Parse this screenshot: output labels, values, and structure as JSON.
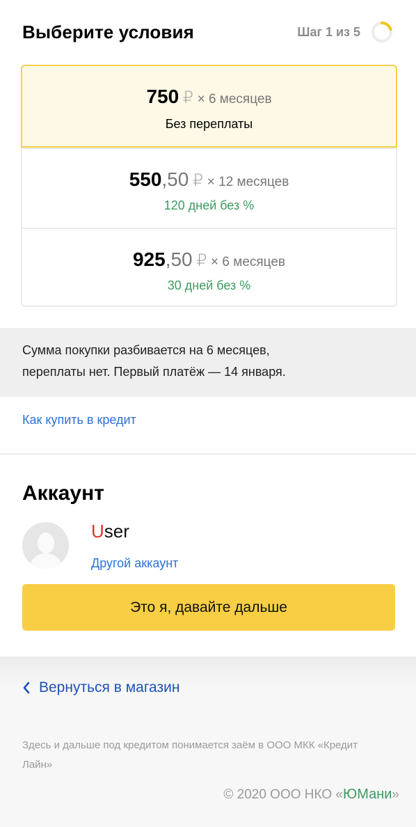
{
  "header": {
    "title": "Выберите условия",
    "step": "Шаг 1 из 5",
    "step_progress": 0.2,
    "ring_color": "#f5c518"
  },
  "options": [
    {
      "amount_main": "750",
      "amount_fraction": "",
      "currency": "₽",
      "multiplier": "× 6 месяцев",
      "subtitle": "Без переплаты",
      "selected": true
    },
    {
      "amount_main": "550",
      "amount_fraction": ",50",
      "currency": "₽",
      "multiplier": "× 12 месяцев",
      "subtitle": "120 дней без %",
      "selected": false
    },
    {
      "amount_main": "925",
      "amount_fraction": ",50",
      "currency": "₽",
      "multiplier": "× 6 месяцев",
      "subtitle": "30 дней без %",
      "selected": false
    }
  ],
  "info": {
    "line1": "Сумма покупки разбивается на 6 месяцев,",
    "line2": "переплаты нет. Первый платёж — 14 января."
  },
  "links": {
    "credit": "Как купить в кредит"
  },
  "account": {
    "title": "Аккаунт",
    "user_first": "U",
    "user_rest": "ser",
    "other": "Другой аккаунт",
    "confirm_button": "Это я, давайте дальше"
  },
  "footer": {
    "back": "Вернуться в магазин",
    "disclaimer": "Здесь и дальше под кредитом понимается заём в ООО МКК «Кредит Лайн»",
    "copyright_prefix": "© 2020  ООО НКО «",
    "copyright_brand": "ЮМани",
    "copyright_suffix": "»"
  },
  "colors": {
    "accent_yellow": "#f8ce45",
    "link_blue": "#2a72d9",
    "green": "#3d9a60",
    "brand_red": "#e0332a"
  }
}
